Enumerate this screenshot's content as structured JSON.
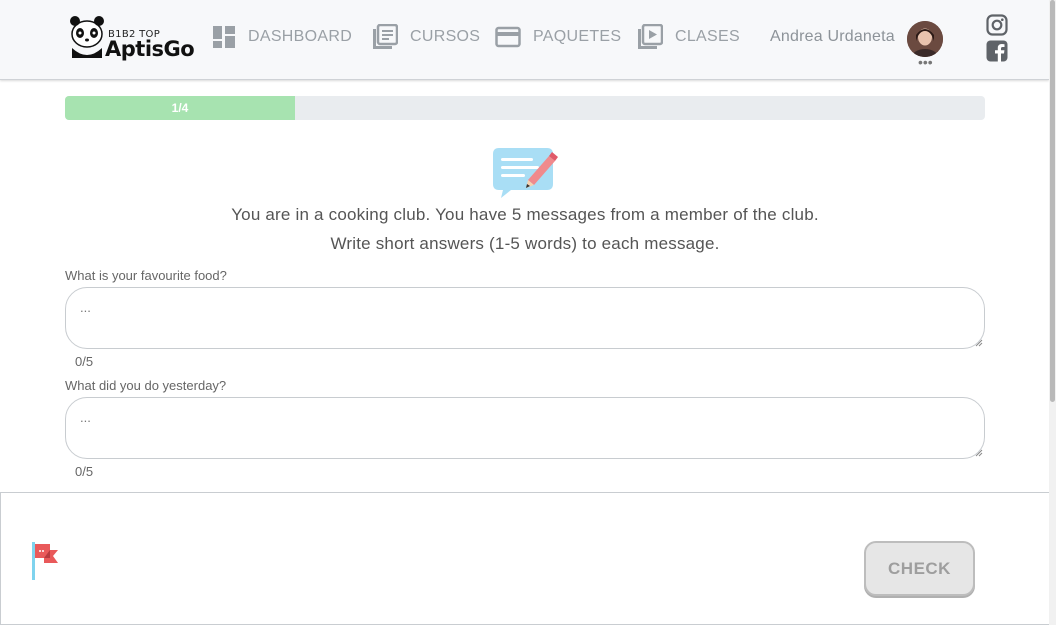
{
  "header": {
    "logo_small": "B1B2 TOP",
    "logo_big": "AptisGo",
    "nav": [
      {
        "label": "DASHBOARD",
        "icon": "dashboard-icon"
      },
      {
        "label": "CURSOS",
        "icon": "book-icon"
      },
      {
        "label": "PAQUETES",
        "icon": "card-icon"
      },
      {
        "label": "CLASES",
        "icon": "play-icon"
      }
    ],
    "user_name": "Andrea Urdaneta",
    "avatar_menu": "•••",
    "social": [
      "instagram-icon",
      "facebook-icon"
    ]
  },
  "progress": {
    "label": "1/4",
    "fraction": 0.25
  },
  "instructions": [
    "You are in a cooking club. You have 5 messages from a member of the club.",
    "Write short answers (1-5 words) to each message."
  ],
  "questions": [
    {
      "label": "What is your favourite food?",
      "placeholder": "...",
      "count": "0/5"
    },
    {
      "label": "What did you do yesterday?",
      "placeholder": "...",
      "count": "0/5"
    }
  ],
  "footer": {
    "check_label": "CHECK"
  },
  "colors": {
    "progress_fill": "#a7e3b0",
    "accent_gray": "#9aa0a6",
    "flag_red": "#e9595a"
  }
}
